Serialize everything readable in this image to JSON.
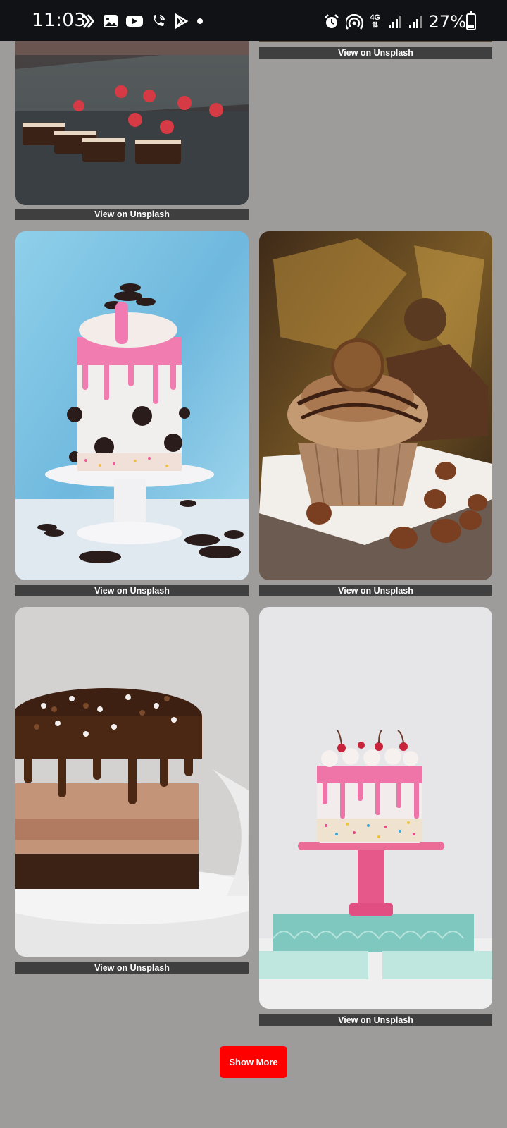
{
  "status_bar": {
    "time": "11:03",
    "battery_percent": "27%",
    "network": "4G",
    "left_icons": [
      "bixby-icon",
      "gallery-icon",
      "youtube-icon",
      "wifi-call-icon",
      "play-store-icon",
      "dot-icon"
    ],
    "right_icons": [
      "alarm-icon",
      "hotspot-icon",
      "4g-icon",
      "signal-icon",
      "signal-icon",
      "battery-icon"
    ]
  },
  "gallery": {
    "link_label": "View on Unsplash",
    "items": [
      {
        "label": "View on Unsplash",
        "subject": "pastry display case"
      },
      {
        "label": "View on Unsplash",
        "subject": "image (cropped)"
      },
      {
        "label": "View on Unsplash",
        "subject": "cookies and cream drip cake"
      },
      {
        "label": "View on Unsplash",
        "subject": "hazelnut chocolate cupcake"
      },
      {
        "label": "View on Unsplash",
        "subject": "chocolate mousse cake"
      },
      {
        "label": "View on Unsplash",
        "subject": "pink drip sprinkle cake"
      }
    ]
  },
  "show_more_label": "Show More",
  "colors": {
    "background": "#9e9b9b",
    "caption_bar": "#3f3f3f",
    "accent": "#ff0000",
    "status_bar": "#111215"
  }
}
